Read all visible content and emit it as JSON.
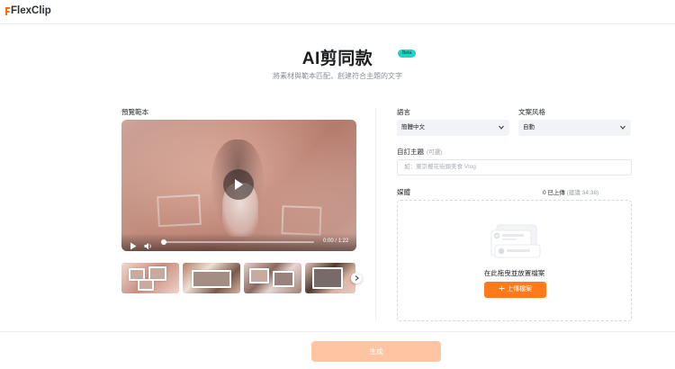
{
  "app": {
    "logo_text": "FlexClip"
  },
  "header": {
    "title": "AI剪同款",
    "badge": "Beta",
    "subtitle": "將素材與範本匹配，創建符合主題的文字"
  },
  "preview": {
    "label": "預覽範本",
    "time": "0:00 / 1:22",
    "progress": 0
  },
  "form": {
    "language": {
      "label": "語言",
      "value": "簡體中文"
    },
    "style": {
      "label": "文案风格",
      "value": "自動"
    },
    "topic": {
      "label": "自訂主題",
      "optional": "(可選)",
      "placeholder": "如：東京櫻花街頭美食 Vlog"
    }
  },
  "media": {
    "label": "媒體",
    "count": "0 已上傳",
    "suggest": "(建議 34:38)",
    "drop_text": "在此拖曳並放置檔案",
    "upload_label": "上傳檔案"
  },
  "footer": {
    "generate_label": "生成"
  },
  "colors": {
    "accent": "#ff7a1a",
    "accent_disabled": "#ffc5a3",
    "beta": "#22d3c5"
  },
  "icons": [
    "flexclip-logo-icon",
    "play-icon",
    "volume-icon",
    "chevron-down-icon",
    "chevron-right-icon",
    "plus-icon",
    "upload-illustration"
  ]
}
